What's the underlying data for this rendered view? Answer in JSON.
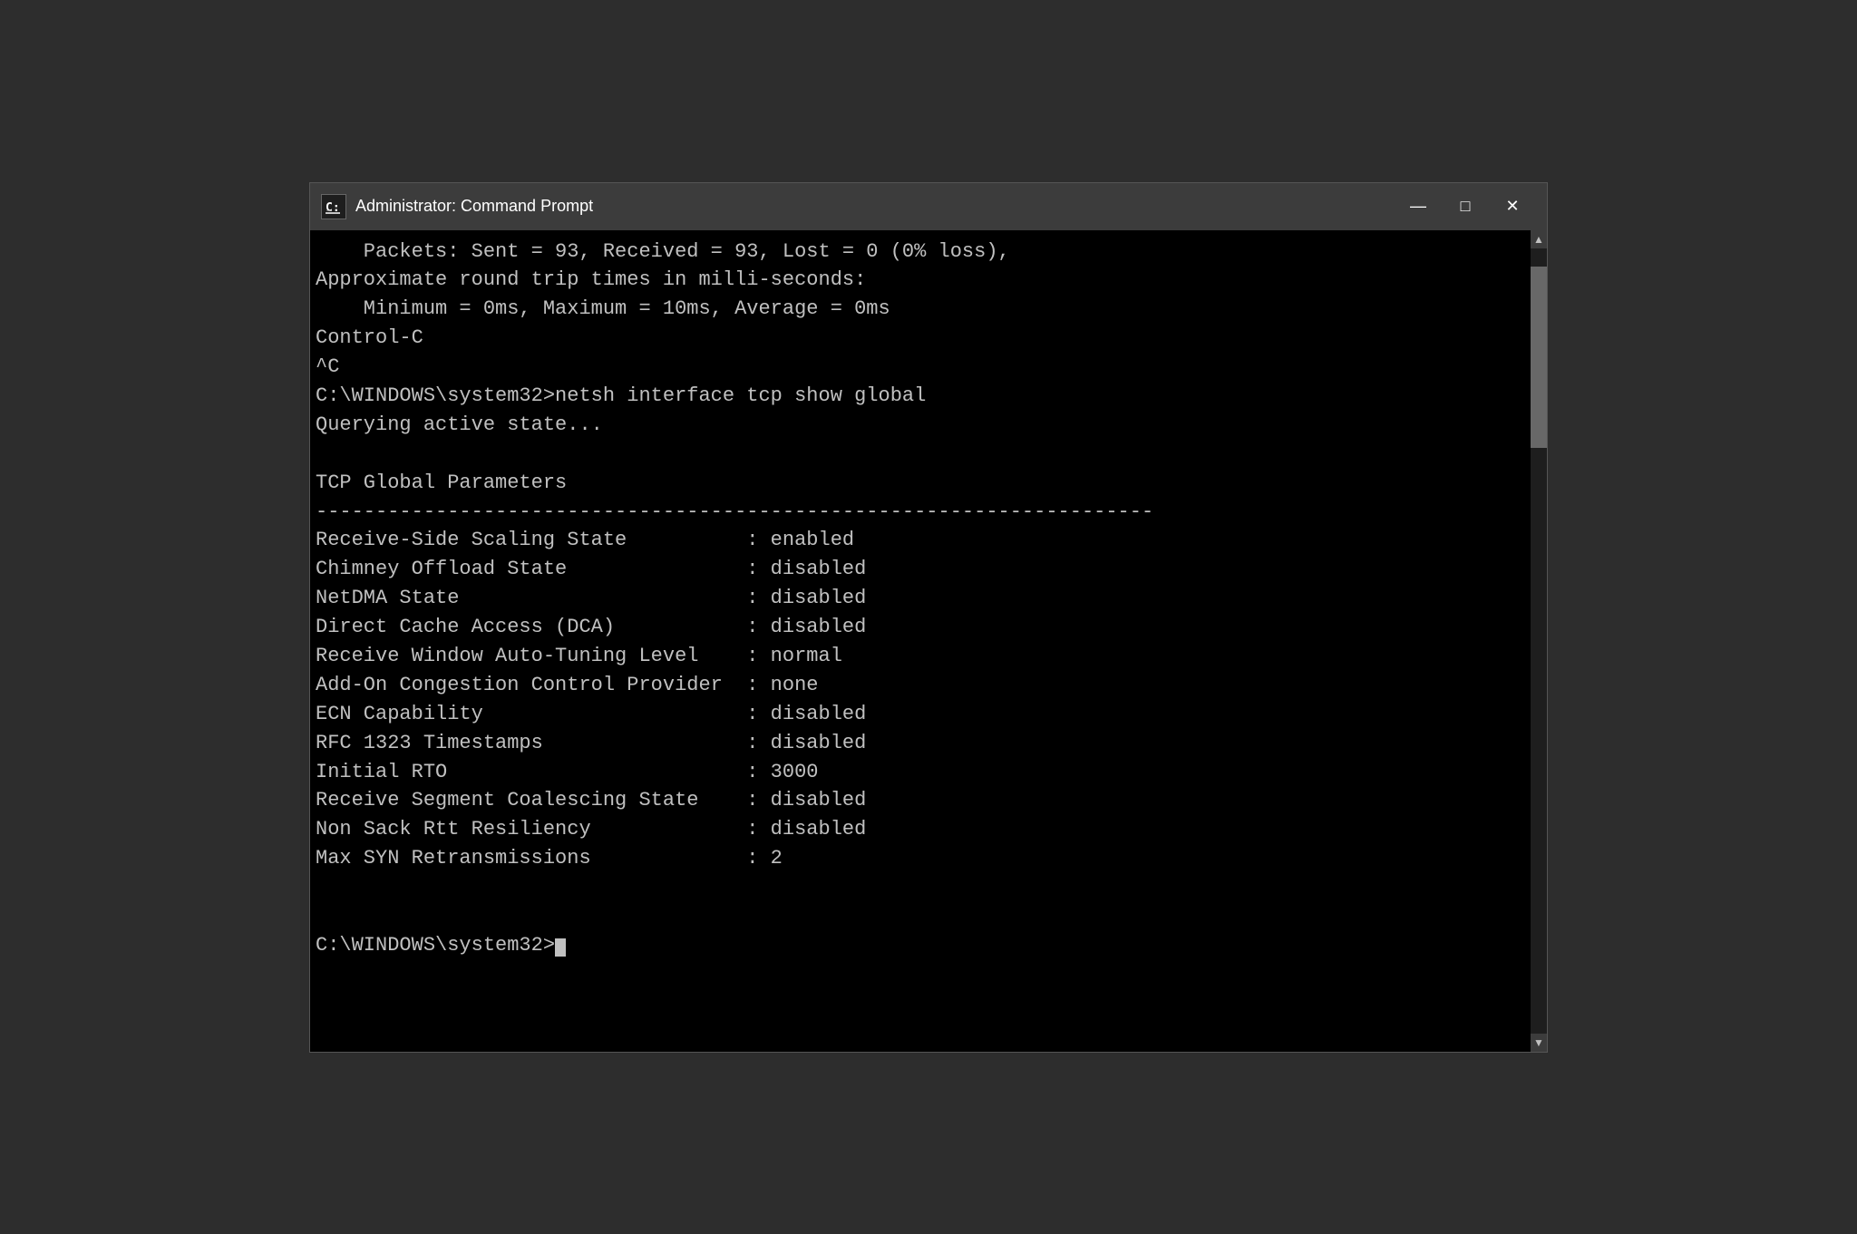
{
  "window": {
    "title": "Administrator: Command Prompt",
    "icon_label": "C:",
    "controls": {
      "minimize": "—",
      "maximize": "□",
      "close": "✕"
    }
  },
  "terminal": {
    "lines": [
      "    Packets: Sent = 93, Received = 93, Lost = 0 (0% loss),",
      "Approximate round trip times in milli-seconds:",
      "    Minimum = 0ms, Maximum = 10ms, Average = 0ms",
      "Control-C",
      "^C",
      "C:\\WINDOWS\\system32>netsh interface tcp show global",
      "Querying active state...",
      "",
      "TCP Global Parameters",
      "----------------------------------------------------------------------",
      "Receive-Side Scaling State          : enabled",
      "Chimney Offload State               : disabled",
      "NetDMA State                        : disabled",
      "Direct Cache Access (DCA)           : disabled",
      "Receive Window Auto-Tuning Level    : normal",
      "Add-On Congestion Control Provider  : none",
      "ECN Capability                      : disabled",
      "RFC 1323 Timestamps                 : disabled",
      "Initial RTO                         : 3000",
      "Receive Segment Coalescing State    : disabled",
      "Non Sack Rtt Resiliency             : disabled",
      "Max SYN Retransmissions             : 2",
      "",
      "",
      "C:\\WINDOWS\\system32>"
    ],
    "prompt_cursor": true
  },
  "scrollbar": {
    "up_arrow": "▲",
    "down_arrow": "▼"
  }
}
